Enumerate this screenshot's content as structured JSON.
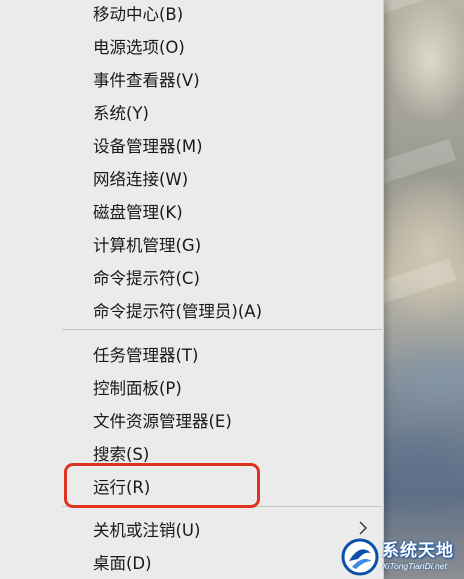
{
  "menu": {
    "group1": [
      {
        "label": "移动中心(B)"
      },
      {
        "label": "电源选项(O)"
      },
      {
        "label": "事件查看器(V)"
      },
      {
        "label": "系统(Y)"
      },
      {
        "label": "设备管理器(M)"
      },
      {
        "label": "网络连接(W)"
      },
      {
        "label": "磁盘管理(K)"
      },
      {
        "label": "计算机管理(G)"
      },
      {
        "label": "命令提示符(C)"
      },
      {
        "label": "命令提示符(管理员)(A)"
      }
    ],
    "group2": [
      {
        "label": "任务管理器(T)"
      },
      {
        "label": "控制面板(P)"
      },
      {
        "label": "文件资源管理器(E)"
      },
      {
        "label": "搜索(S)"
      },
      {
        "label": "运行(R)"
      }
    ],
    "group3": [
      {
        "label": "关机或注销(U)",
        "icon": "chevron-right-icon"
      },
      {
        "label": "桌面(D)"
      }
    ]
  },
  "highlight_color": "#e0331f",
  "watermark": {
    "title": "系统天地",
    "subtitle": "XiTongTianDi.net",
    "brand_color": "#0a4fa8"
  }
}
